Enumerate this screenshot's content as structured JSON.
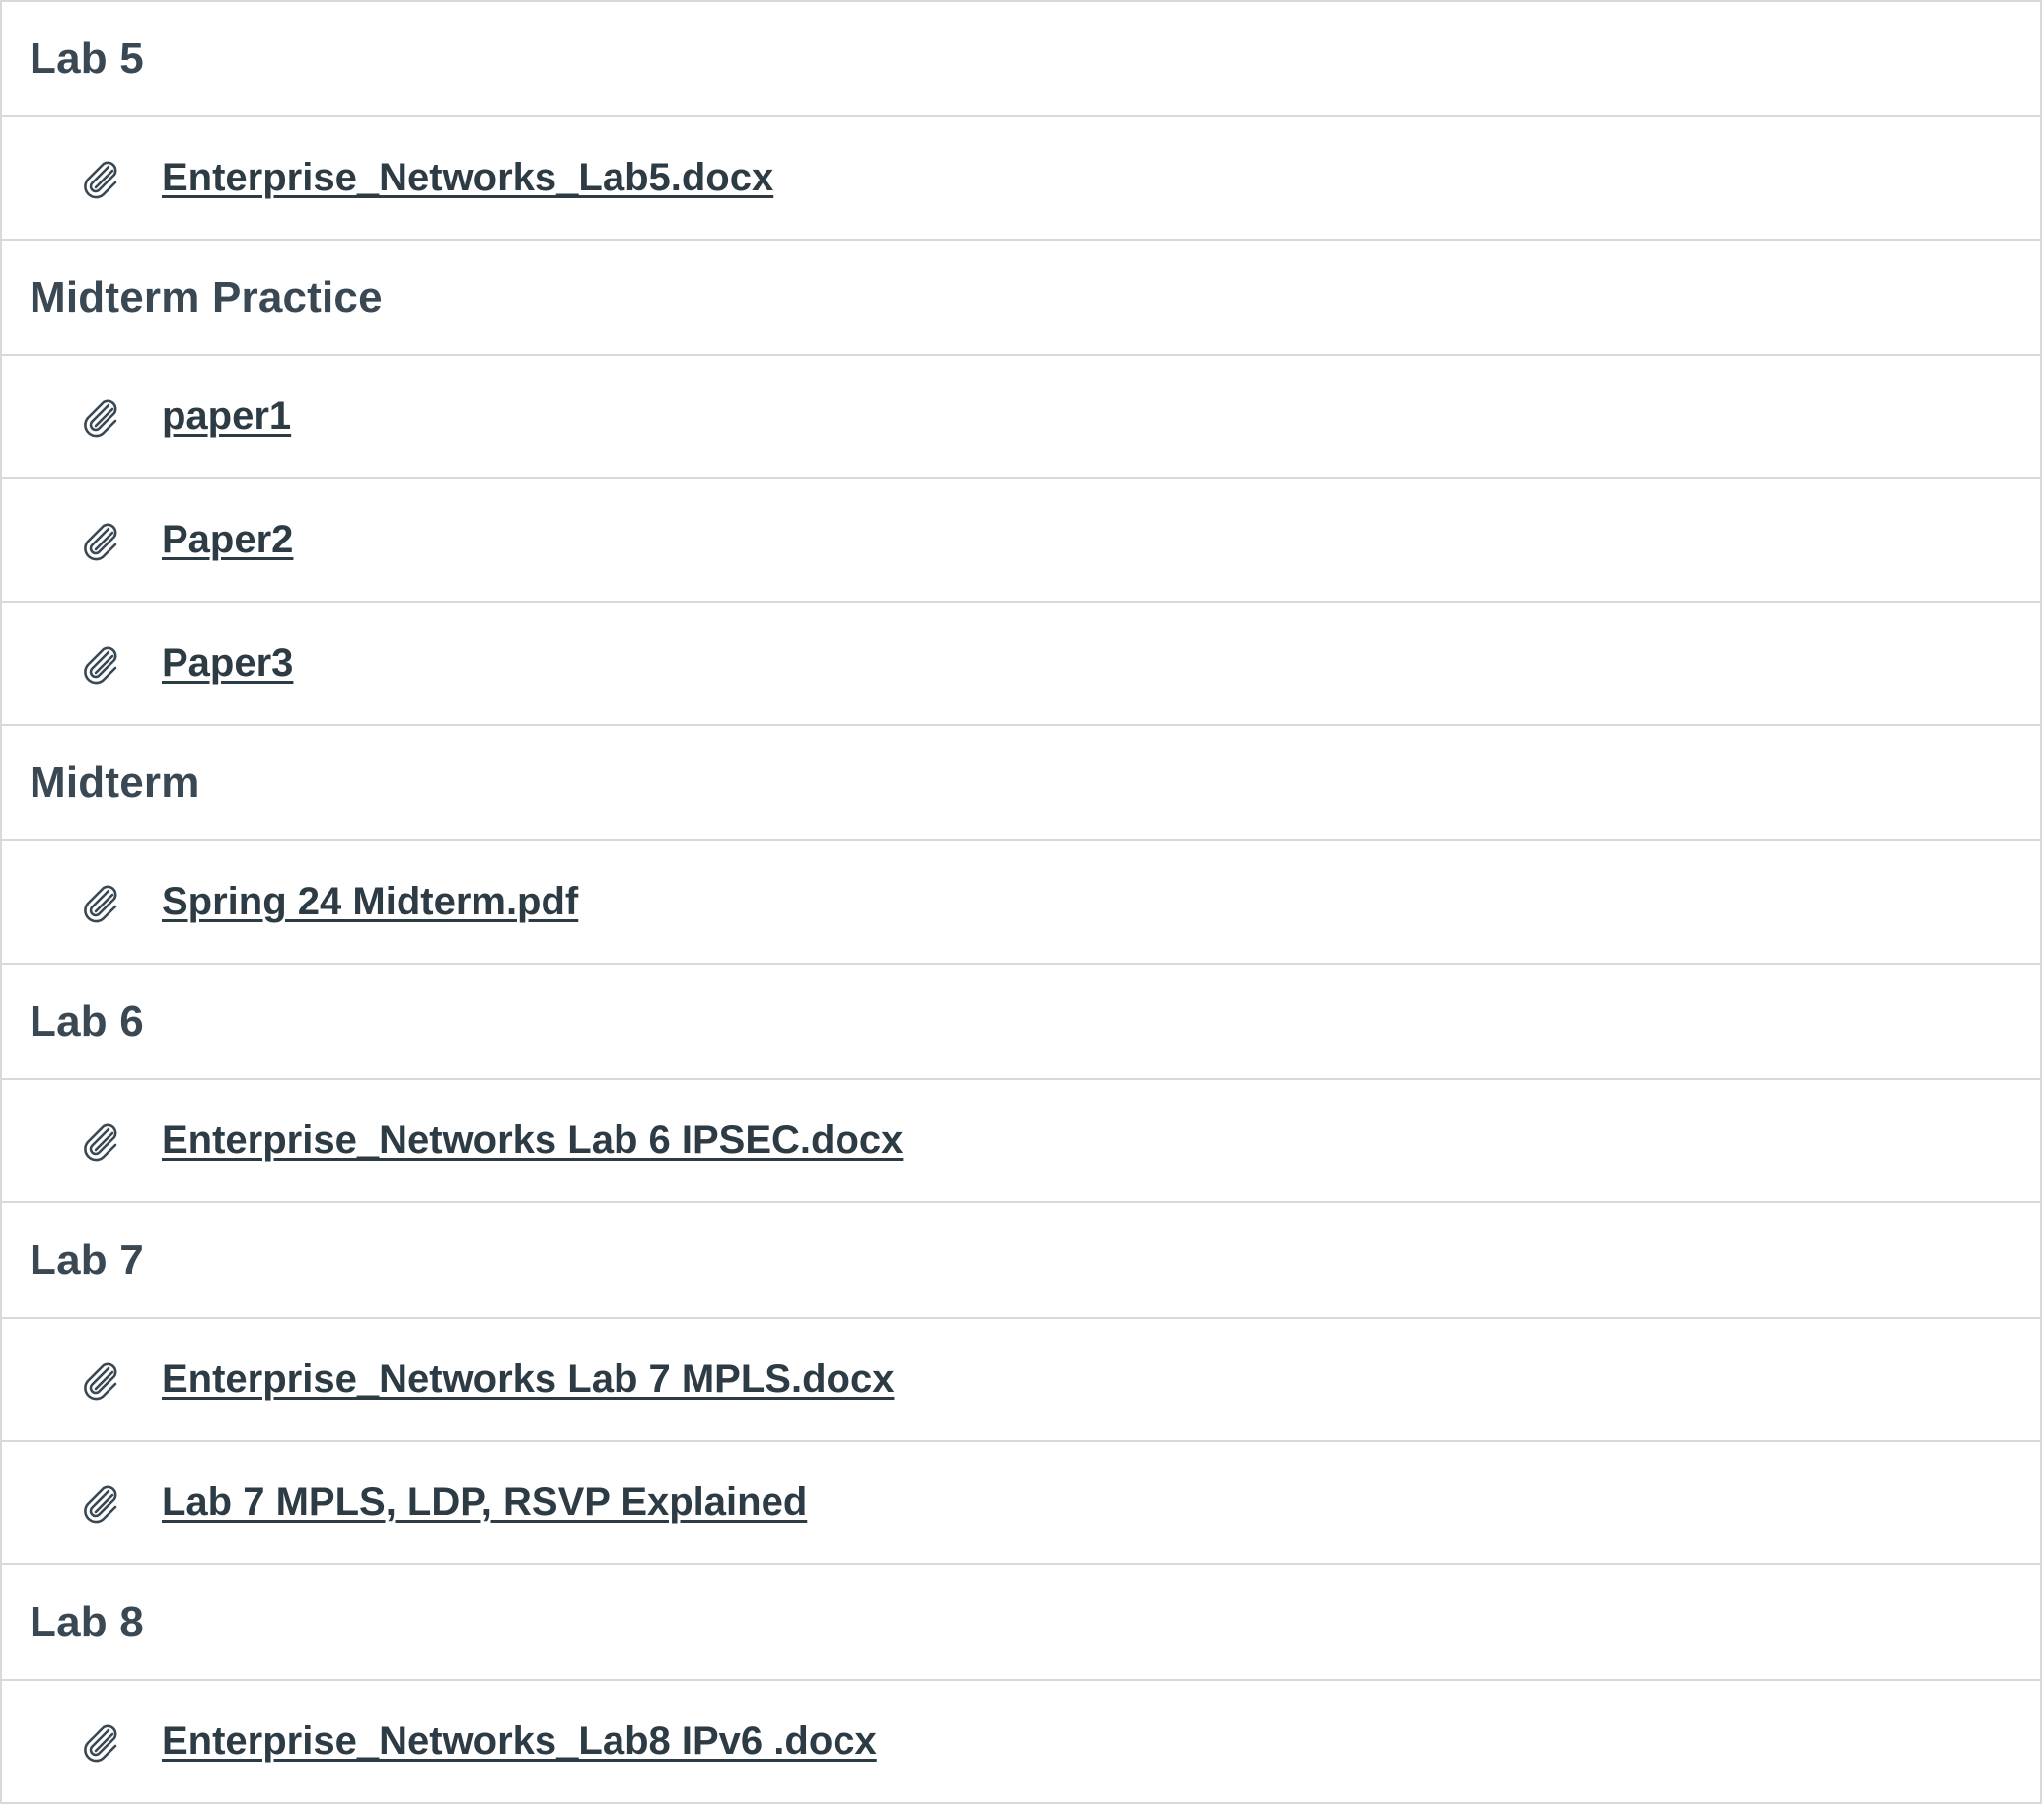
{
  "modules": [
    {
      "title": "Lab 5",
      "items": [
        {
          "label": "Enterprise_Networks_Lab5.docx",
          "icon": "paperclip-icon"
        }
      ]
    },
    {
      "title": "Midterm Practice",
      "items": [
        {
          "label": "paper1",
          "icon": "paperclip-icon"
        },
        {
          "label": "Paper2",
          "icon": "paperclip-icon"
        },
        {
          "label": "Paper3",
          "icon": "paperclip-icon"
        }
      ]
    },
    {
      "title": "Midterm",
      "items": [
        {
          "label": "Spring 24 Midterm.pdf",
          "icon": "paperclip-icon"
        }
      ]
    },
    {
      "title": "Lab 6",
      "items": [
        {
          "label": "Enterprise_Networks Lab 6 IPSEC.docx",
          "icon": "paperclip-icon"
        }
      ]
    },
    {
      "title": "Lab 7",
      "items": [
        {
          "label": "Enterprise_Networks Lab 7 MPLS.docx",
          "icon": "paperclip-icon"
        },
        {
          "label": "Lab 7 MPLS, LDP, RSVP Explained",
          "icon": "paperclip-icon"
        }
      ]
    },
    {
      "title": "Lab 8",
      "items": [
        {
          "label": "Enterprise_Networks_Lab8 IPv6 .docx",
          "icon": "paperclip-icon"
        }
      ]
    }
  ],
  "colors": {
    "text": "#2d3b45",
    "header_text": "#3a4854",
    "border": "#d7dadc",
    "icon": "#3a4854"
  }
}
